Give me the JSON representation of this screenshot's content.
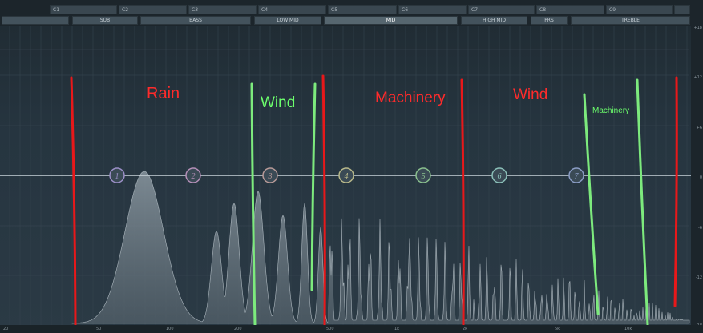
{
  "note_row": [
    "C1",
    "C2",
    "C3",
    "C4",
    "C5",
    "C6",
    "C7",
    "C8",
    "C9"
  ],
  "band_row": [
    {
      "label": "SUB",
      "active": false
    },
    {
      "label": "BASS",
      "active": false
    },
    {
      "label": "LOW MID",
      "active": false
    },
    {
      "label": "MID",
      "active": true
    },
    {
      "label": "HIGH MID",
      "active": false
    },
    {
      "label": "PRS",
      "active": false
    },
    {
      "label": "TREBLE",
      "active": false
    }
  ],
  "eq_nodes": [
    "1",
    "2",
    "3",
    "4",
    "5",
    "6",
    "7"
  ],
  "eq_node_colors": [
    "#9b8fc7",
    "#b58fb8",
    "#b89a98",
    "#b8b88a",
    "#8ac08e",
    "#8abfb8",
    "#8a9cc4"
  ],
  "annotations": [
    {
      "text": "Rain",
      "color": "#ff2b2b"
    },
    {
      "text": "Wind",
      "color": "#6cff6c"
    },
    {
      "text": "Machinery",
      "color": "#ff2b2b"
    },
    {
      "text": "Wind",
      "color": "#ff2b2b"
    },
    {
      "text": "Machinery",
      "color": "#6cff6c"
    }
  ],
  "freq_ticks": [
    "20",
    "50",
    "100",
    "200",
    "500",
    "1k",
    "2k",
    "5k",
    "10k"
  ],
  "db_ticks": [
    "+18",
    "+12",
    "+6",
    "0",
    "-6",
    "-12",
    "-18"
  ],
  "colors": {
    "divider_red": "#e8181a",
    "divider_green": "#7dea7d",
    "spectrum": "#6f7b84",
    "zero_line": "#c9d4da"
  }
}
